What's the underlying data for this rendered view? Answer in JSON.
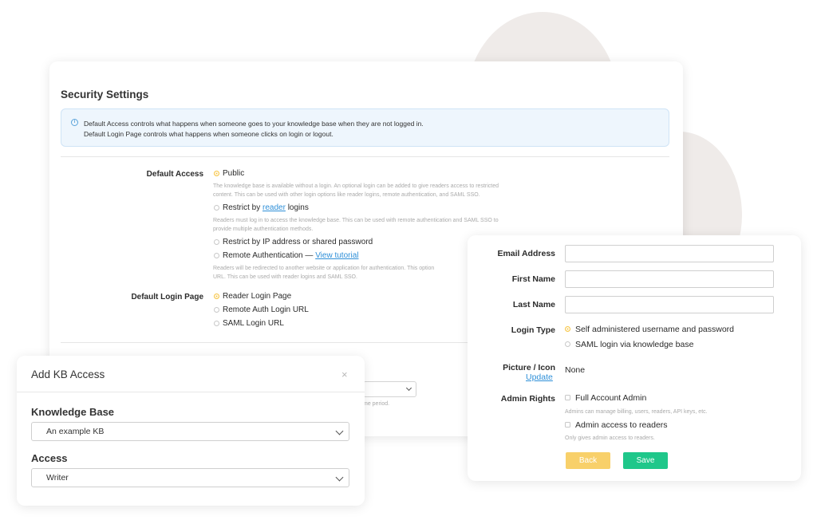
{
  "security": {
    "title": "Security Settings",
    "info_line1": "Default Access controls what happens when someone goes to your knowledge base when they are not logged in.",
    "info_line2": "Default Login Page controls what happens when someone clicks on login or logout.",
    "default_access_label": "Default Access",
    "public_label": "Public",
    "public_help1": "The knowledge base is available without a login. An optional login can be added to give readers access to restricted",
    "public_help2": "content. This can be used with other login options like reader logins, remote authentication, and SAML SSO.",
    "restrict_prefix": "Restrict by ",
    "restrict_link": "reader",
    "restrict_suffix": " logins",
    "restrict_help1": "Readers must log in to access the knowledge base. This can be used with remote authentication and SAML SSO to",
    "restrict_help2": "provide multiple authentication methods.",
    "ip_label": "Restrict by IP address or shared password",
    "remote_prefix": "Remote Authentication — ",
    "remote_link": "View tutorial",
    "remote_help1": "Readers will be redirected to another website or application for authentication. This option",
    "remote_help2": "URL. This can be used with reader logins and SAML SSO.",
    "login_page_label": "Default Login Page",
    "login_options": [
      "Reader Login Page",
      "Remote Auth Login URL",
      "SAML Login URL"
    ],
    "hidden_help": "me period."
  },
  "addkb": {
    "title": "Add KB Access",
    "close": "×",
    "kb_label": "Knowledge Base",
    "kb_value": "An example KB",
    "access_label": "Access",
    "access_value": "Writer"
  },
  "user": {
    "email_label": "Email Address",
    "first_label": "First Name",
    "last_label": "Last Name",
    "login_type_label": "Login Type",
    "login_types": [
      "Self administered username and password",
      "SAML login via knowledge base"
    ],
    "picture_label": "Picture / Icon",
    "update_link": "Update",
    "picture_value": "None",
    "admin_label": "Admin Rights",
    "full_admin": "Full Account Admin",
    "full_admin_help": "Admins can manage billing, users, readers, API keys, etc.",
    "reader_admin": "Admin access to readers",
    "reader_admin_help": "Only gives admin access to readers.",
    "back": "Back",
    "save": "Save"
  },
  "colors": {
    "accent_yellow": "#f7c544",
    "save_green": "#1fc78a",
    "link_blue": "#2e8fd8"
  }
}
